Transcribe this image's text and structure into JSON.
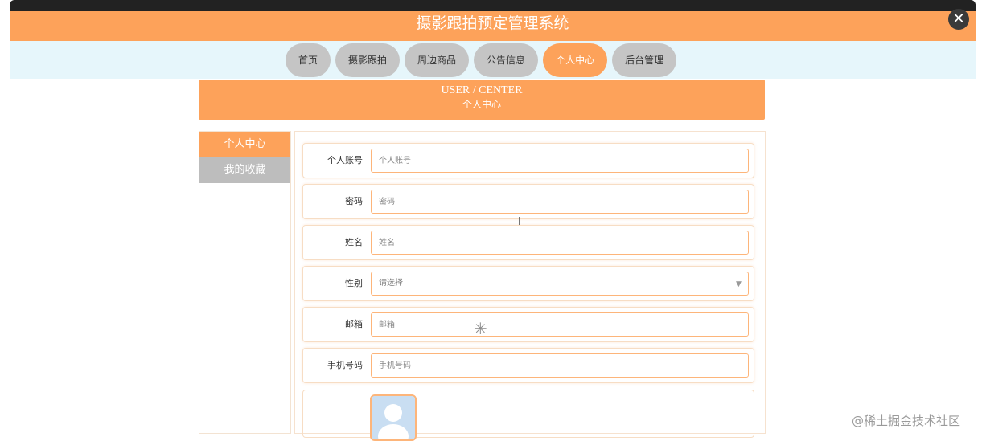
{
  "header": {
    "title": "摄影跟拍预定管理系统",
    "close_icon": "close-icon",
    "close_symbol": "✕"
  },
  "nav": {
    "items": [
      {
        "label": "首页"
      },
      {
        "label": "摄影跟拍"
      },
      {
        "label": "周边商品"
      },
      {
        "label": "公告信息"
      },
      {
        "label": "个人中心",
        "active": true
      },
      {
        "label": "后台管理"
      }
    ]
  },
  "banner": {
    "title_en": "USER / CENTER",
    "title_zh": "个人中心"
  },
  "sidebar": {
    "items": [
      {
        "label": "个人中心",
        "active": true
      },
      {
        "label": "我的收藏",
        "active": false
      }
    ]
  },
  "form": {
    "fields": [
      {
        "label": "个人账号",
        "placeholder": "个人账号"
      },
      {
        "label": "密码",
        "placeholder": "密码"
      },
      {
        "label": "姓名",
        "placeholder": "姓名"
      },
      {
        "label": "性别",
        "selected": "请选择"
      },
      {
        "label": "邮箱",
        "placeholder": "邮箱"
      },
      {
        "label": "手机号码",
        "placeholder": "手机号码"
      }
    ],
    "avatar_icon": "avatar-placeholder-icon"
  },
  "overlay": {
    "cursor_symbol": "I",
    "spinner_symbol": "✳"
  },
  "watermark": "@稀土掘金技术社区",
  "colors": {
    "accent": "#fda25a",
    "nav_bg": "#e6f6fb",
    "inactive": "#c5c5c5"
  }
}
